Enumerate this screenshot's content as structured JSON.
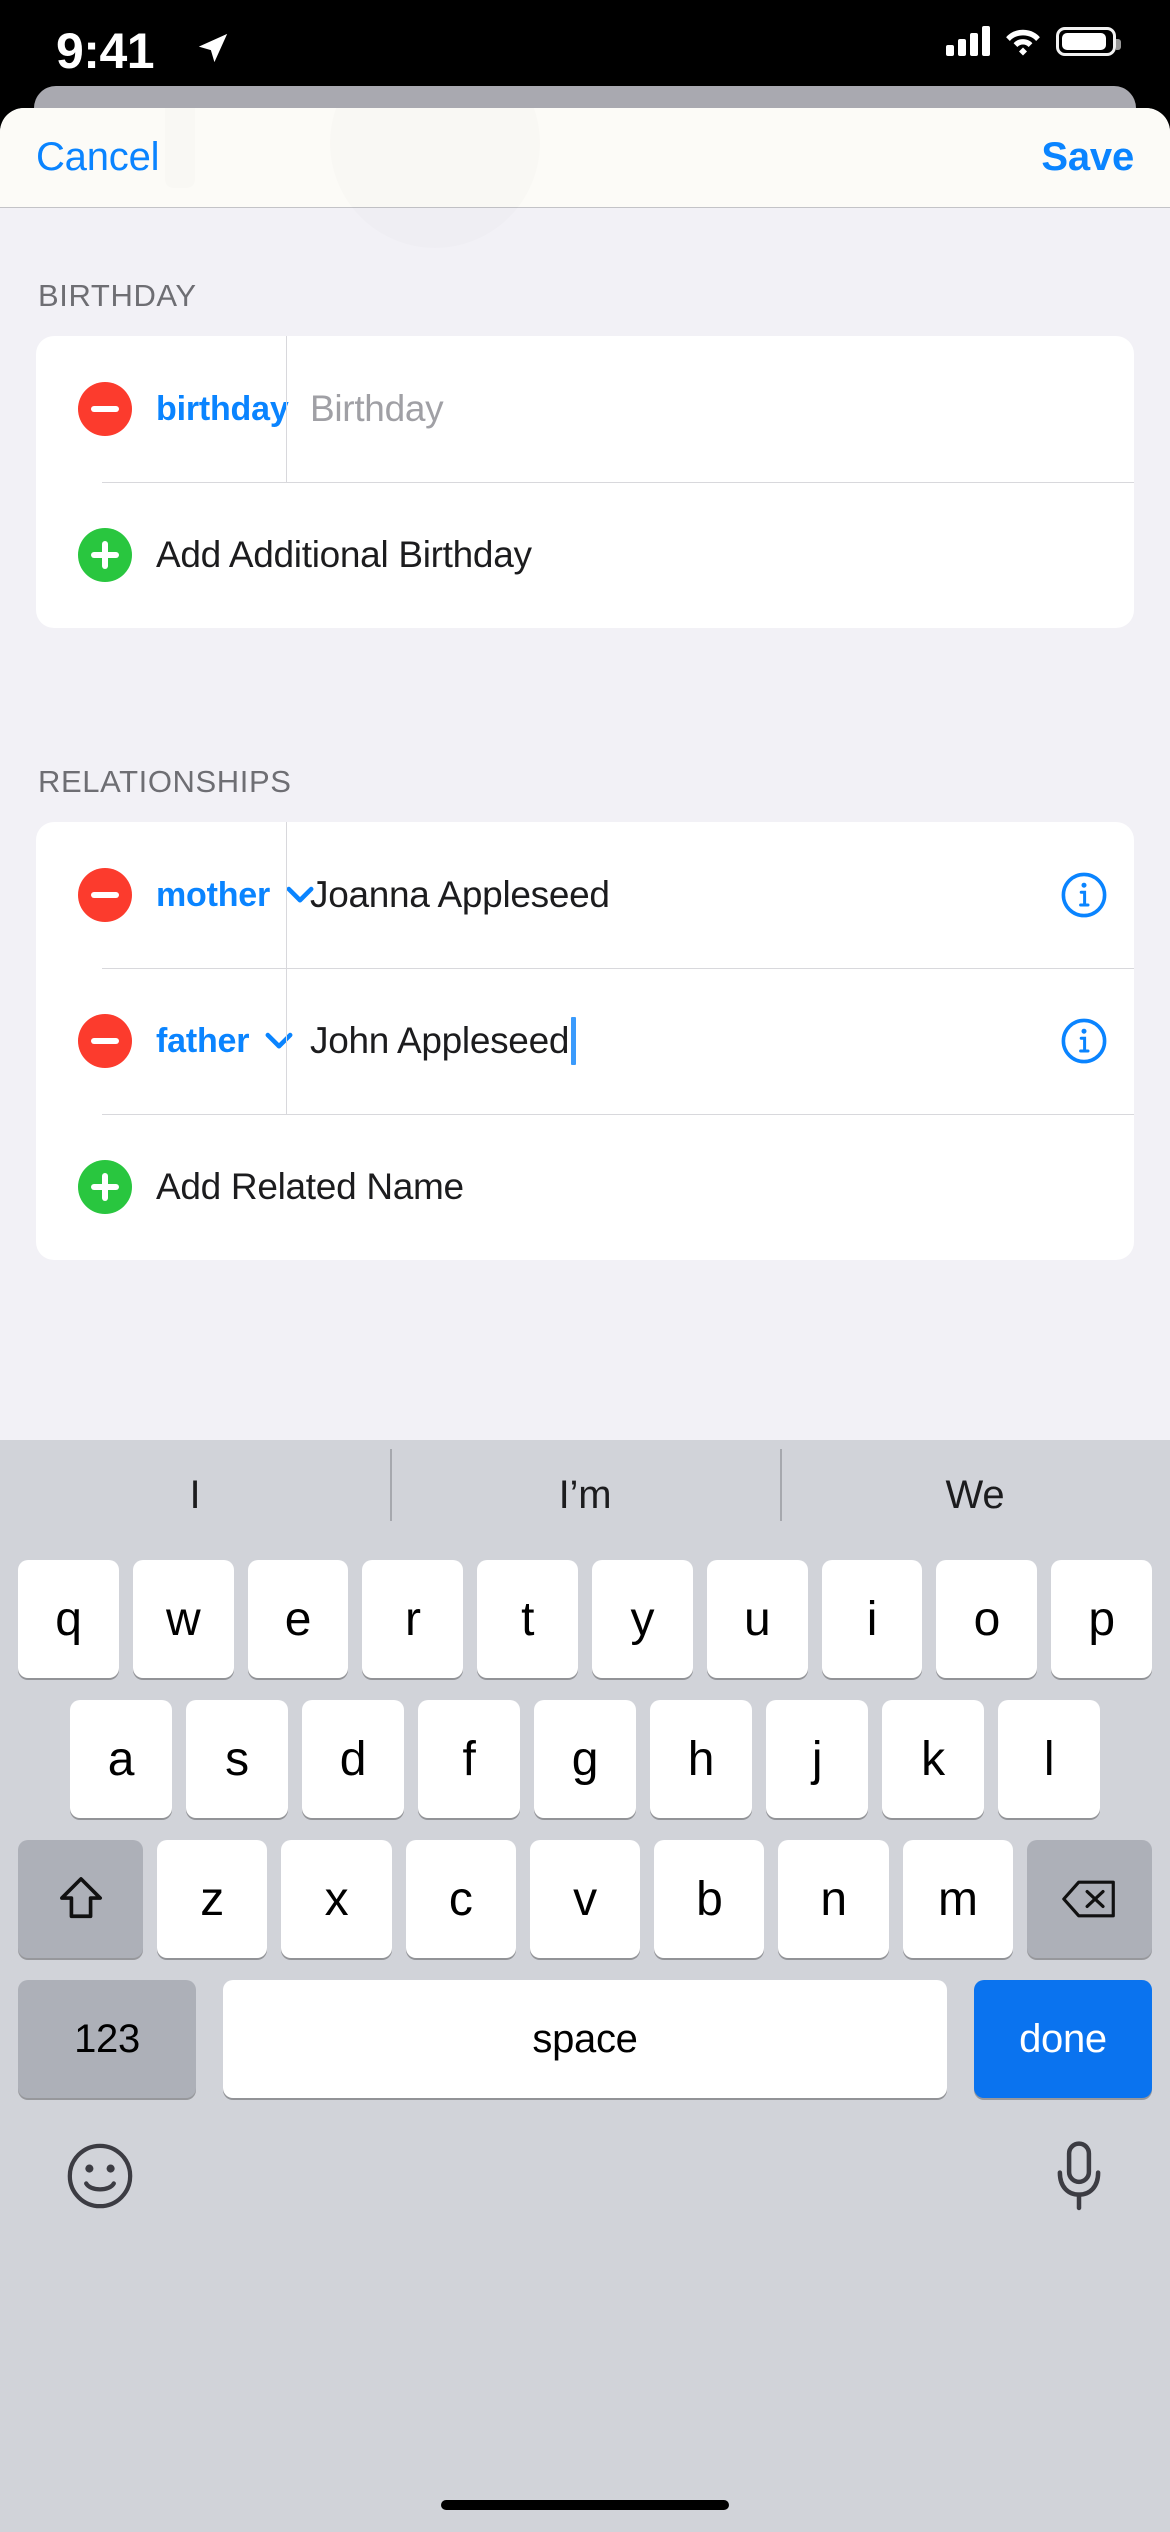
{
  "status_bar": {
    "time": "9:41",
    "location_icon": "location-arrow-icon",
    "cellular_icon": "cellular-bars-icon",
    "wifi_icon": "wifi-icon",
    "battery_icon": "battery-full-icon"
  },
  "nav": {
    "cancel_label": "Cancel",
    "save_label": "Save",
    "accent_color": "#0a84ff"
  },
  "sections": [
    {
      "header": "BIRTHDAY",
      "rows": [
        {
          "delete_icon": "minus-circle-icon",
          "label": "birthday",
          "value": "",
          "placeholder": "Birthday",
          "has_chevron": false,
          "has_info": false,
          "has_caret": false
        }
      ],
      "add_row": {
        "add_icon": "plus-circle-icon",
        "label": "Add Additional Birthday"
      }
    },
    {
      "header": "RELATIONSHIPS",
      "rows": [
        {
          "delete_icon": "minus-circle-icon",
          "label": "mother",
          "value": "Joanna Appleseed",
          "placeholder": "",
          "has_chevron": true,
          "has_info": true,
          "has_caret": false
        },
        {
          "delete_icon": "minus-circle-icon",
          "label": "father",
          "value": "John Appleseed",
          "placeholder": "",
          "has_chevron": true,
          "has_info": true,
          "has_caret": true
        }
      ],
      "add_row": {
        "add_icon": "plus-circle-icon",
        "label": "Add Related Name"
      }
    }
  ],
  "keyboard": {
    "suggestions": [
      "I",
      "I’m",
      "We"
    ],
    "row1": [
      "q",
      "w",
      "e",
      "r",
      "t",
      "y",
      "u",
      "i",
      "o",
      "p"
    ],
    "row2": [
      "a",
      "s",
      "d",
      "f",
      "g",
      "h",
      "j",
      "k",
      "l"
    ],
    "row3_letters": [
      "z",
      "x",
      "c",
      "v",
      "b",
      "n",
      "m"
    ],
    "shift_icon": "shift-arrow-icon",
    "backspace_icon": "backspace-icon",
    "numbers_label": "123",
    "space_label": "space",
    "done_label": "done",
    "emoji_icon": "emoji-smiley-icon",
    "dictation_icon": "microphone-icon",
    "done_color": "#0a73ef"
  },
  "colors": {
    "delete_red": "#fc3b2d",
    "add_green": "#29c63f",
    "ios_blue": "#0a84ff",
    "sheet_bg": "#f2f1f6",
    "keyboard_bg": "#d1d3d9"
  }
}
